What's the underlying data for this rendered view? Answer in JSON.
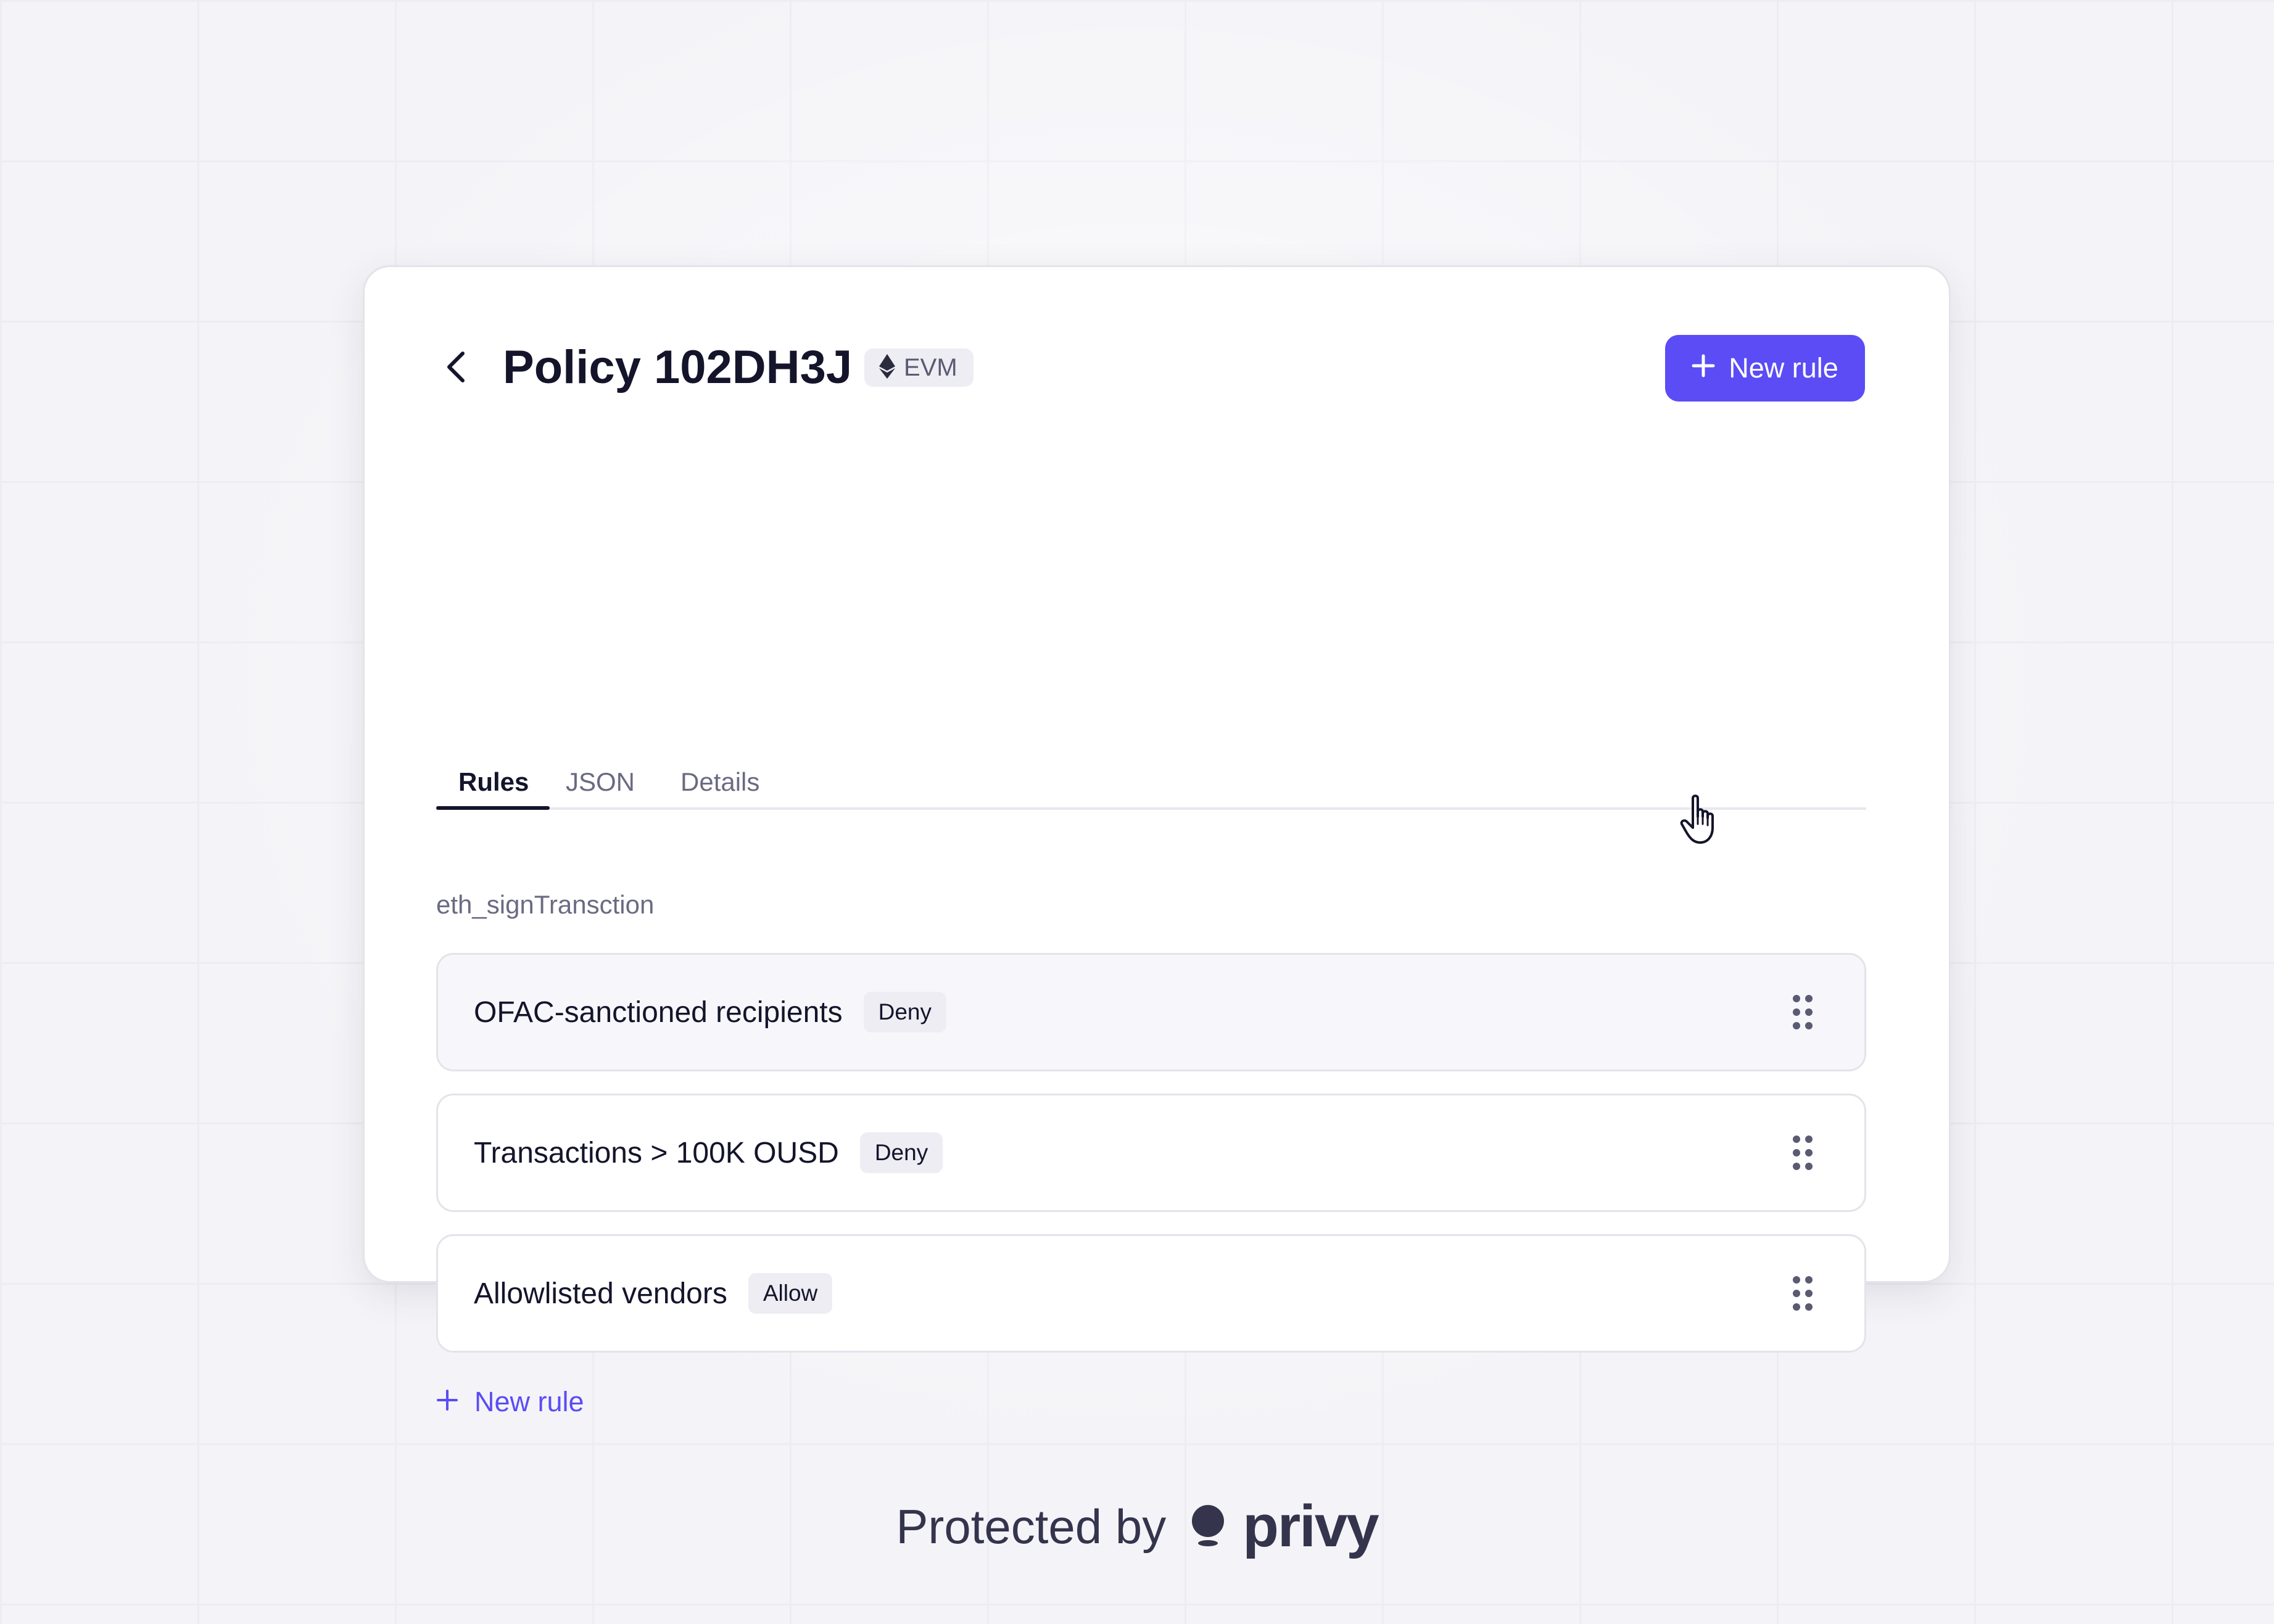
{
  "header": {
    "title": "Policy 102DH3J",
    "chain_badge": "EVM",
    "new_rule_button": "New rule"
  },
  "tabs": [
    {
      "label": "Rules",
      "active": true
    },
    {
      "label": "JSON",
      "active": false
    },
    {
      "label": "Details",
      "active": false
    }
  ],
  "section": {
    "method_label": "eth_signTransction"
  },
  "rules": [
    {
      "title": "OFAC-sanctioned recipients",
      "action": "Deny",
      "hovered": true
    },
    {
      "title": "Transactions > 100K OUSD",
      "action": "Deny",
      "hovered": false
    },
    {
      "title": "Allowlisted vendors",
      "action": "Allow",
      "hovered": false
    }
  ],
  "add_rule_link": "New rule",
  "footer": {
    "text": "Protected by",
    "brand": "privy"
  },
  "colors": {
    "accent": "#5b4cf5",
    "text_primary": "#14142b",
    "text_secondary": "#6a6a82",
    "badge_bg": "#ededf3",
    "background": "#f4f4f8"
  },
  "icons": {
    "back": "chevron-left-icon",
    "chain": "ethereum-icon",
    "add": "plus-icon",
    "drag": "drag-handle-icon",
    "cursor": "hand-pointer-icon",
    "logo": "privy-logo-icon"
  }
}
